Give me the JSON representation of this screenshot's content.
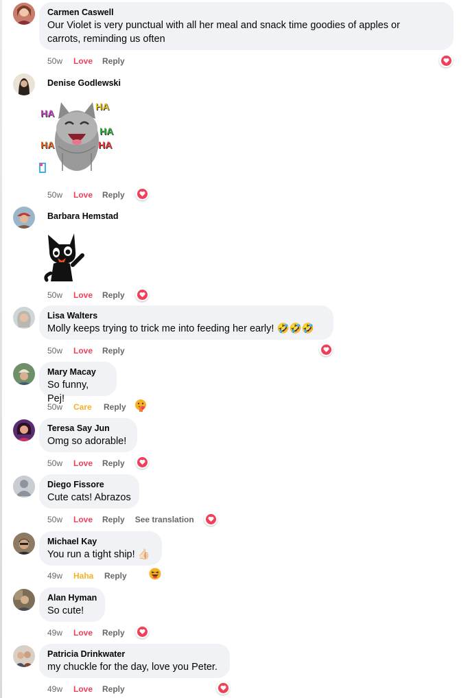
{
  "colors": {
    "love": "#f33e58",
    "care": "#f7b125",
    "haha": "#f7b125",
    "meta": "#65676b",
    "bubble": "#f0f2f5"
  },
  "comments": [
    {
      "author": "Carmen Caswell",
      "text_line1": "Our Violet is very punctual with all her meal and snack time goodies of apples or",
      "text_line2": "carrots, reminding us often",
      "age": "50w",
      "reaction": "Love",
      "reply": "Reply",
      "badge": "heart-icon"
    },
    {
      "author": "Denise Godlewski",
      "sticker": "laughing-cat-ha-sticker",
      "sticker_letters": [
        "HA",
        "HA",
        "HA",
        "HA",
        "HA"
      ],
      "age": "50w",
      "reaction": "Love",
      "reply": "Reply",
      "badge": "heart-icon"
    },
    {
      "author": "Barbara Hemstad",
      "sticker": "black-cat-sticker",
      "age": "50w",
      "reaction": "Love",
      "reply": "Reply",
      "badge": "heart-icon"
    },
    {
      "author": "Lisa Walters",
      "text": "Molly keeps trying to trick me into feeding her early! 🤣🤣🤣",
      "age": "50w",
      "reaction": "Love",
      "reply": "Reply",
      "badge": "heart-icon"
    },
    {
      "author": "Mary Macay",
      "text": "So funny, Pej!",
      "age": "50w",
      "reaction": "Care",
      "reply": "Reply",
      "badge": "care-icon"
    },
    {
      "author": "Teresa Say Jun",
      "text": "Omg so adorable!",
      "age": "50w",
      "reaction": "Love",
      "reply": "Reply",
      "badge": "heart-icon"
    },
    {
      "author": "Diego Fissore",
      "text": "Cute cats! Abrazos",
      "age": "50w",
      "reaction": "Love",
      "reply": "Reply",
      "translate": "See translation",
      "badge": "heart-icon"
    },
    {
      "author": "Michael Kay",
      "text": "You run a tight ship! 👍🏻",
      "age": "49w",
      "reaction": "Haha",
      "reply": "Reply",
      "badge": "haha-icon"
    },
    {
      "author": "Alan Hyman",
      "text": "So cute!",
      "age": "49w",
      "reaction": "Love",
      "reply": "Reply",
      "badge": "heart-icon"
    },
    {
      "author": "Patricia Drinkwater",
      "text": "my chuckle for the day, love you Peter.",
      "age": "49w",
      "reaction": "Love",
      "reply": "Reply",
      "badge": "heart-icon"
    }
  ]
}
